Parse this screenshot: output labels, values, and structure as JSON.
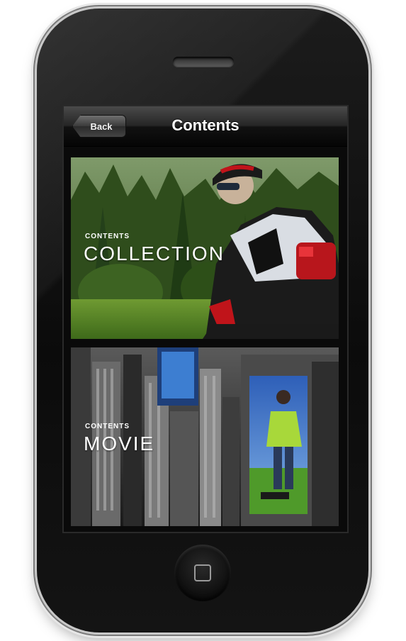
{
  "navbar": {
    "back_label": "Back",
    "title": "Contents"
  },
  "cards": [
    {
      "kicker": "CONTENTS",
      "heading": "COLLECTION"
    },
    {
      "kicker": "CONTENTS",
      "heading": "MOVIE"
    }
  ]
}
